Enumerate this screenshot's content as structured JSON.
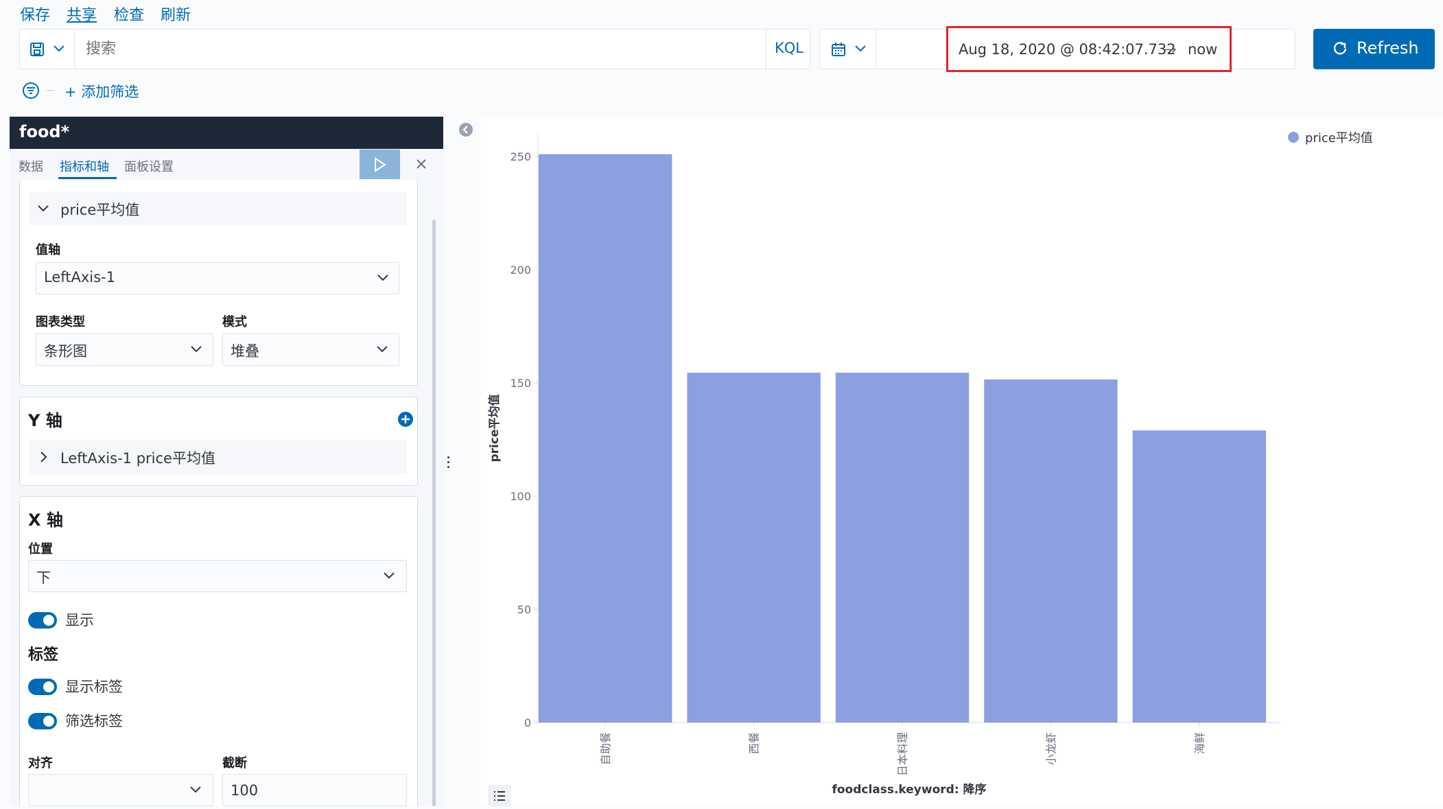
{
  "top_menu": {
    "save": "保存",
    "share": "共享",
    "inspect": "检查",
    "refresh": "刷新"
  },
  "query_bar": {
    "search_placeholder": "搜索",
    "kql": "KQL",
    "time_start": "Aug 18, 2020 @ 08:42:07.732",
    "time_arrow": "→",
    "time_end": "now",
    "refresh_button": "Refresh",
    "add_filter": "+ 添加筛选"
  },
  "editor": {
    "title": "food*",
    "tabs": [
      "数据",
      "指标和轴",
      "面板设置"
    ],
    "series": {
      "name": "price平均值",
      "value_axis_label": "值轴",
      "value_axis": "LeftAxis-1",
      "chart_type_label": "图表类型",
      "chart_type": "条形图",
      "mode_label": "模式",
      "mode": "堆叠"
    },
    "y_axis": {
      "title": "Y 轴",
      "item": "LeftAxis-1 price平均值"
    },
    "x_axis": {
      "title": "X 轴",
      "position_label": "位置",
      "position": "下",
      "show_label": "显示",
      "labels_title": "标签",
      "show_labels": "显示标签",
      "filter_labels": "筛选标签",
      "align_label": "对齐",
      "align_value": "",
      "truncate_label": "截断",
      "truncate_value": "100"
    }
  },
  "colors": {
    "accent": "#006bb4",
    "bar": "#8c9fe0",
    "header": "#1d2939",
    "highlight": "#e1242a"
  },
  "chart_data": {
    "type": "bar",
    "categories": [
      "自助餐",
      "西餐",
      "日本料理",
      "小龙虾",
      "海鲜"
    ],
    "series": [
      {
        "name": "price平均值",
        "values": [
          251,
          154.5,
          154.5,
          151.5,
          129
        ]
      }
    ],
    "xlabel": "foodclass.keyword: 降序",
    "ylabel": "price平均值",
    "ylim": [
      0,
      260
    ],
    "yticks": [
      0,
      50,
      100,
      150,
      200,
      250
    ],
    "legend": "top-right",
    "grid": false
  }
}
